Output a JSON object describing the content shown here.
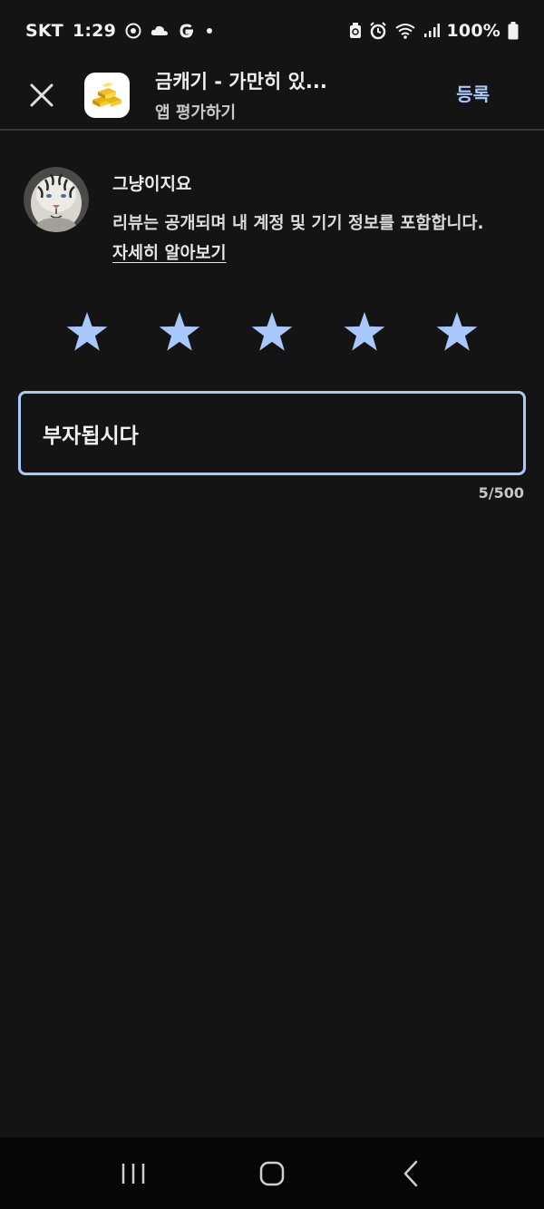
{
  "status_bar": {
    "carrier": "SKT",
    "time": "1:29",
    "battery": "100%",
    "icons_left": [
      "chrome-icon",
      "cloud-icon",
      "google-g-icon",
      "dot-icon"
    ],
    "icons_right": [
      "recycle-icon",
      "alarm-icon",
      "wifi-icon",
      "signal-icon",
      "battery-icon"
    ]
  },
  "header": {
    "app_title": "금캐기 - 가만히 있...",
    "subtitle": "앱 평가하기",
    "submit_label": "등록"
  },
  "user": {
    "name": "그냥이지요",
    "disclaimer_text": "리뷰는 공개되며 내 계정 및 기기 정보를 포함합니다. ",
    "learn_more": "자세히 알아보기"
  },
  "rating": {
    "value": 5,
    "max": 5,
    "color": "#a8c7fa"
  },
  "review": {
    "text": "부자됩시다",
    "char_count": "5/500"
  },
  "colors": {
    "background": "#141414",
    "accent": "#a8c7fa",
    "nav_bar": "#060606"
  }
}
